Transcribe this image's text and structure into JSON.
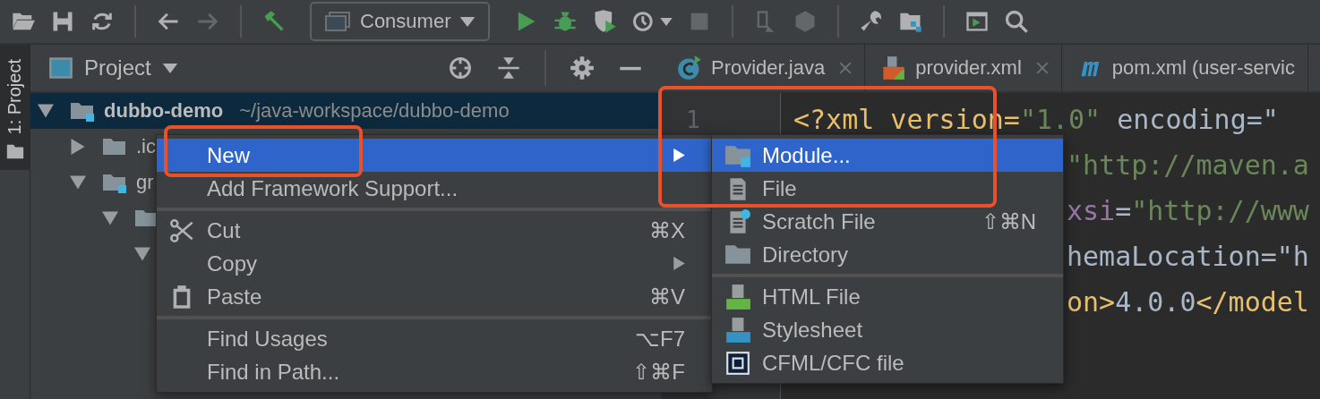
{
  "toolbar": {
    "items": [
      {
        "kind": "open",
        "disabled": false
      },
      {
        "kind": "save",
        "disabled": false
      },
      {
        "kind": "sync",
        "disabled": false
      },
      {
        "kind": "separator"
      },
      {
        "kind": "back",
        "disabled": false
      },
      {
        "kind": "forward",
        "disabled": true
      },
      {
        "kind": "separator"
      },
      {
        "kind": "hammer",
        "disabled": false
      },
      {
        "kind": "config",
        "label": "Consumer"
      },
      {
        "kind": "run",
        "disabled": false
      },
      {
        "kind": "debug",
        "disabled": false
      },
      {
        "kind": "coverage",
        "disabled": false
      },
      {
        "kind": "profile",
        "disabled": false
      },
      {
        "kind": "stop",
        "disabled": true
      },
      {
        "kind": "separator"
      },
      {
        "kind": "device",
        "disabled": true
      },
      {
        "kind": "package",
        "disabled": true
      },
      {
        "kind": "separator"
      },
      {
        "kind": "wrench",
        "disabled": false
      },
      {
        "kind": "structure",
        "disabled": false
      },
      {
        "kind": "separator"
      },
      {
        "kind": "terminal",
        "disabled": false
      },
      {
        "kind": "search",
        "disabled": false
      }
    ]
  },
  "side_stripe": {
    "label": "1: Project"
  },
  "project_panel": {
    "title": "Project",
    "tree": [
      {
        "label": "dubbo-demo",
        "path": "~/java-workspace/dubbo-demo",
        "kind": "module",
        "expanded": true,
        "selected": true,
        "children": [
          {
            "label": ".ic",
            "kind": "folder",
            "expanded": false,
            "selected": false
          },
          {
            "label": "gr",
            "kind": "module",
            "expanded": true,
            "selected": false,
            "children": [
              {
                "kind": "folder",
                "expanded": true,
                "selected": false,
                "children": [
                  {
                    "expanded": true,
                    "selected": false
                  }
                ]
              }
            ]
          }
        ]
      }
    ]
  },
  "editor": {
    "tabs": [
      {
        "label": "Provider.java",
        "kind": "java",
        "closable": true
      },
      {
        "label": "provider.xml",
        "kind": "xml",
        "closable": true
      },
      {
        "label": "pom.xml (user-servic",
        "kind": "maven",
        "closable": false
      }
    ],
    "line_numbers": [
      "1"
    ],
    "lines": [
      {
        "kind": "full",
        "segments": [
          {
            "text": "<?xml version=",
            "kind": "tag"
          },
          {
            "text": "\"1.0\"",
            "kind": "string"
          },
          {
            "text": " encoding=\"",
            "kind": "plain"
          }
        ]
      },
      {
        "kind": "covered",
        "segments": [
          {
            "text": "\"http://maven.a",
            "kind": "string"
          }
        ]
      },
      {
        "kind": "covered",
        "segments": [
          {
            "text": "xsi",
            "kind": "attr"
          },
          {
            "text": "=",
            "kind": "plain"
          },
          {
            "text": "\"http://www",
            "kind": "string"
          }
        ]
      },
      {
        "kind": "covered",
        "segments": [
          {
            "text": "hemaLocation=\"h",
            "kind": "plain"
          }
        ]
      },
      {
        "kind": "covered",
        "segments": [
          {
            "text": "on>",
            "kind": "tag"
          },
          {
            "text": "4.0.0",
            "kind": "plain"
          },
          {
            "text": "</model",
            "kind": "tag"
          }
        ]
      }
    ]
  },
  "context_menu": {
    "framed": true,
    "items": [
      {
        "kind": "plain",
        "label": "New",
        "submenu": true,
        "selected": true
      },
      {
        "kind": "plain",
        "label": "Add Framework Support...",
        "submenu": false,
        "selected": false
      },
      {
        "kind": "separator"
      },
      {
        "kind": "scissors",
        "label": "Cut",
        "shortcut": "⌘X",
        "submenu": false,
        "selected": false
      },
      {
        "kind": "plain",
        "label": "Copy",
        "submenu": true,
        "selected": false
      },
      {
        "kind": "clipboard",
        "label": "Paste",
        "shortcut": "⌘V",
        "submenu": false,
        "selected": false
      },
      {
        "kind": "separator"
      },
      {
        "kind": "plain",
        "label": "Find Usages",
        "shortcut": "⌥F7",
        "submenu": false,
        "selected": false
      },
      {
        "kind": "plain",
        "label": "Find in Path...",
        "shortcut": "⇧⌘F",
        "submenu": false,
        "selected": false
      }
    ]
  },
  "submenu": {
    "framed": true,
    "items": [
      {
        "kind": "module",
        "label": "Module...",
        "selected": true
      },
      {
        "kind": "file",
        "label": "File",
        "selected": false
      },
      {
        "kind": "scratch",
        "label": "Scratch File",
        "shortcut": "⇧⌘N",
        "selected": false
      },
      {
        "kind": "folder",
        "label": "Directory",
        "selected": false
      },
      {
        "kind": "separator"
      },
      {
        "kind": "html",
        "label": "HTML File",
        "selected": false
      },
      {
        "kind": "css",
        "label": "Stylesheet",
        "selected": false
      },
      {
        "kind": "cfml",
        "label": "CFML/CFC file",
        "selected": false
      }
    ]
  }
}
